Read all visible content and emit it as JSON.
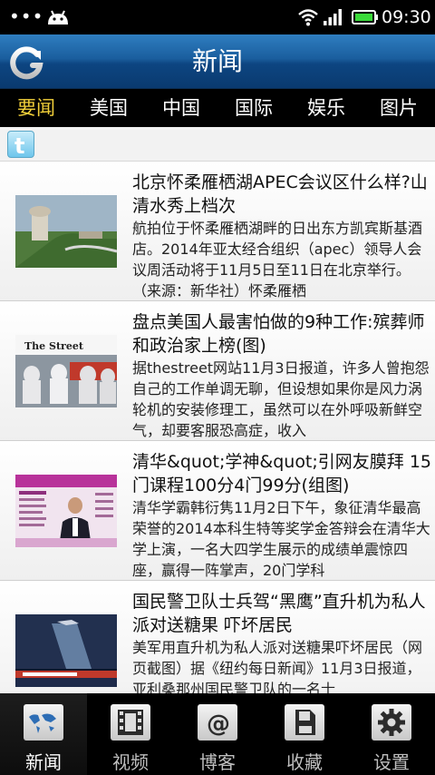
{
  "statusbar": {
    "dots": "•••",
    "time": "09:30",
    "icons": [
      "android-icon",
      "wifi-icon",
      "signal-icon",
      "battery-icon"
    ]
  },
  "header": {
    "title": "新闻",
    "refresh_icon": "refresh-icon"
  },
  "tabs": [
    {
      "label": "要闻",
      "active": true
    },
    {
      "label": "美国",
      "active": false
    },
    {
      "label": "中国",
      "active": false
    },
    {
      "label": "国际",
      "active": false
    },
    {
      "label": "娱乐",
      "active": false
    },
    {
      "label": "图片",
      "active": false
    }
  ],
  "share": {
    "icon": "twitter-icon"
  },
  "articles": [
    {
      "title": "北京怀柔雁栖湖APEC会议区什么样?山清水秀上档次",
      "summary": "航拍位于怀柔雁栖湖畔的日出东方凯宾斯基酒店。2014年亚太经合组织（apec）领导人会议周活动将于11月5日至11日在北京举行。（来源：新华社）怀柔雁栖"
    },
    {
      "title": "盘点美国人最害怕做的9种工作:殡葬师和政治家上榜(图)",
      "summary": "据thestreet网站11月3日报道，许多人曾抱怨自己的工作单调无聊，但设想如果你是风力涡轮机的安装修理工，虽然可以在外呼吸新鲜空气，却要客服恐高症，收入",
      "thumb_caption": "The Street"
    },
    {
      "title": "清华&quot;学神&quot;引网友膜拜 15门课程100分4门99分(组图)",
      "summary": "清华学霸韩衍隽11月2日下午，象征清华最高荣誉的2014本科生特等奖学金答辩会在清华大学上演，一名大四学生展示的成绩单震惊四座，赢得一阵掌声，20门学科"
    },
    {
      "title": "国民警卫队士兵驾“黑鹰”直升机为私人派对送糖果 吓坏居民",
      "summary": "美军用直升机为私人派对送糖果吓坏居民（网页截图）据《纽约每日新闻》11月3日报道，亚利桑那州国民警卫队的一名士"
    }
  ],
  "bottomnav": [
    {
      "label": "新闻",
      "icon": "world-map-icon",
      "active": true
    },
    {
      "label": "视频",
      "icon": "film-icon",
      "active": false
    },
    {
      "label": "博客",
      "icon": "at-sign-icon",
      "active": false
    },
    {
      "label": "收藏",
      "icon": "save-icon",
      "active": false
    },
    {
      "label": "设置",
      "icon": "gear-icon",
      "active": false
    }
  ]
}
